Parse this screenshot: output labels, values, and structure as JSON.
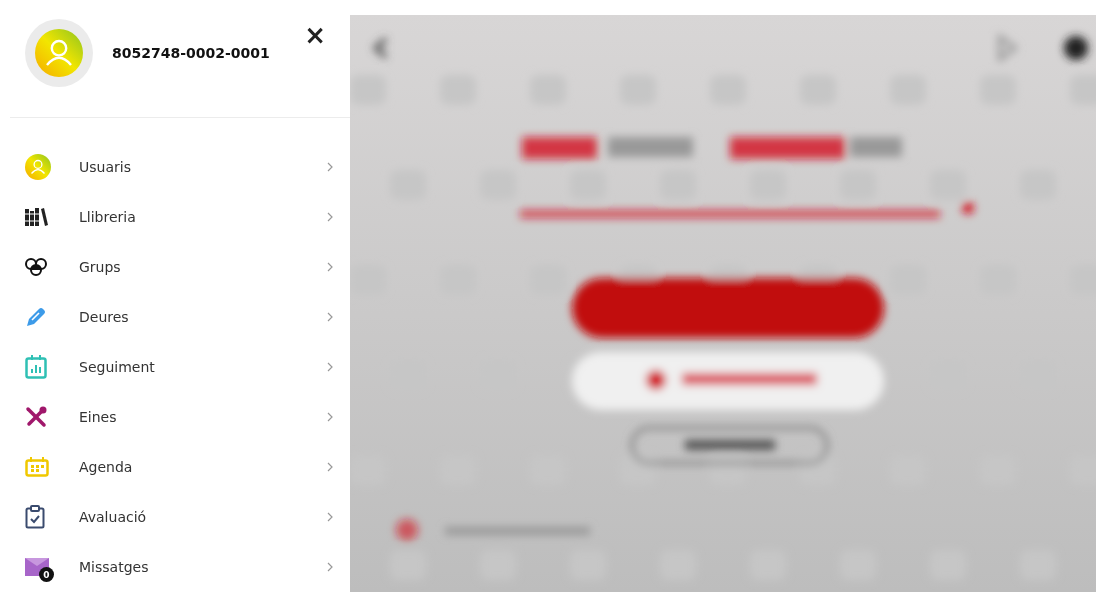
{
  "sidebar": {
    "user_id": "8052748-0002-0001",
    "close": "×",
    "items": [
      {
        "label": "Usuaris"
      },
      {
        "label": "Llibreria"
      },
      {
        "label": "Grups"
      },
      {
        "label": "Deures"
      },
      {
        "label": "Seguiment"
      },
      {
        "label": "Eines"
      },
      {
        "label": "Agenda"
      },
      {
        "label": "Avaluació"
      },
      {
        "label": "Missatges",
        "badge": "0"
      }
    ]
  }
}
